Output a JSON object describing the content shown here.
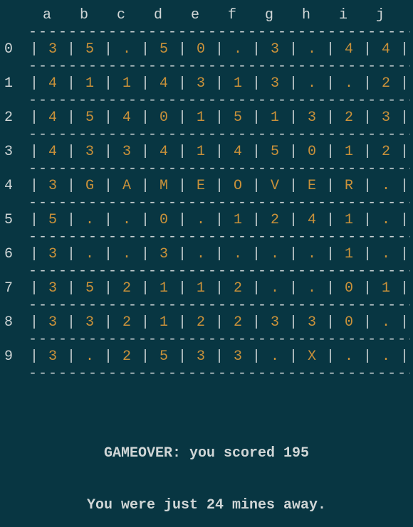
{
  "columns": [
    "a",
    "b",
    "c",
    "d",
    "e",
    "f",
    "g",
    "h",
    "i",
    "j"
  ],
  "row_labels": [
    "0",
    "1",
    "2",
    "3",
    "4",
    "5",
    "6",
    "7",
    "8",
    "9"
  ],
  "grid": [
    [
      "3",
      "5",
      ".",
      "5",
      "0",
      ".",
      "3",
      ".",
      "4",
      "4"
    ],
    [
      "4",
      "1",
      "1",
      "4",
      "3",
      "1",
      "3",
      ".",
      ".",
      "2"
    ],
    [
      "4",
      "5",
      "4",
      "0",
      "1",
      "5",
      "1",
      "3",
      "2",
      "3"
    ],
    [
      "4",
      "3",
      "3",
      "4",
      "1",
      "4",
      "5",
      "0",
      "1",
      "2"
    ],
    [
      "3",
      "G",
      "A",
      "M",
      "E",
      "O",
      "V",
      "E",
      "R",
      "."
    ],
    [
      "5",
      ".",
      ".",
      "0",
      ".",
      "1",
      "2",
      "4",
      "1",
      "."
    ],
    [
      "3",
      ".",
      ".",
      "3",
      ".",
      ".",
      ".",
      ".",
      "1",
      "."
    ],
    [
      "3",
      "5",
      "2",
      "1",
      "1",
      "2",
      ".",
      ".",
      "0",
      "1"
    ],
    [
      "3",
      "3",
      "2",
      "1",
      "2",
      "2",
      "3",
      "3",
      "0",
      "."
    ],
    [
      "3",
      ".",
      "2",
      "5",
      "3",
      "3",
      ".",
      "X",
      ".",
      "."
    ]
  ],
  "dash_text": "----------------------------------------------",
  "bar_char": "|",
  "messages": {
    "line1": "GAMEOVER: you scored 195",
    "line2": "You were just 24 mines away."
  }
}
